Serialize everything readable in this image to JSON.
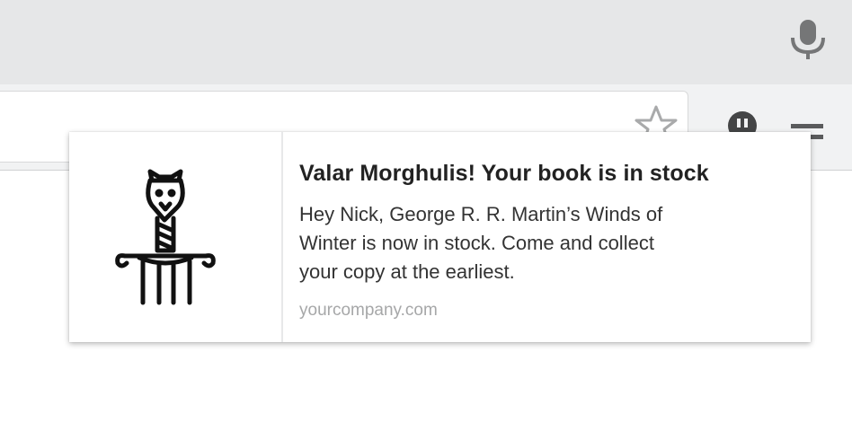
{
  "browser": {
    "icons": {
      "microphone": "microphone-icon",
      "bookmark": "star-icon",
      "extension": "extension-icon",
      "menu": "menu-icon"
    }
  },
  "notification": {
    "title": "Valar Morghulis! Your book is in stock",
    "body_lines": [
      "Hey Nick, George R. R. Martin’s Winds of",
      "Winter is now in stock. Come and collect",
      "your copy at the earliest."
    ],
    "origin": "yourcompany.com",
    "image_icon": "wolf-lectern-icon"
  }
}
